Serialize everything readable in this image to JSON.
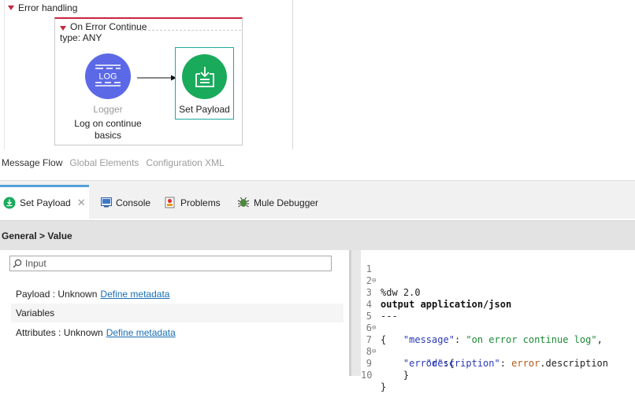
{
  "canvas": {
    "section_title": "Error handling",
    "scope": {
      "title": "On Error Continue",
      "subtitle": "type: ANY"
    },
    "logger": {
      "icon_text": "LOG",
      "type_label": "Logger",
      "name_line1": "Log on continue",
      "name_line2": "basics"
    },
    "set_payload": {
      "label": "Set Payload"
    }
  },
  "flow_tabs": [
    "Message Flow",
    "Global Elements",
    "Configuration XML"
  ],
  "view_tabs": [
    {
      "label": "Set Payload",
      "icon": "set-payload-icon"
    },
    {
      "label": "Console",
      "icon": "console-icon"
    },
    {
      "label": "Problems",
      "icon": "problems-icon"
    },
    {
      "label": "Mule Debugger",
      "icon": "debugger-icon"
    }
  ],
  "breadcrumb": "General > Value",
  "metadata": {
    "search_placeholder": "Input",
    "payload_label": "Payload : Unknown",
    "payload_link": "Define metadata",
    "variables_label": "Variables",
    "attributes_label": "Attributes : Unknown",
    "attributes_link": "Define metadata"
  },
  "code": {
    "line_numbers": [
      "1",
      "2",
      "3",
      "4",
      "5",
      "6",
      "7",
      "8",
      "9",
      "10"
    ],
    "l1": "%dw 2.0",
    "l3": "output application/json",
    "l4": "---",
    "l5": "{",
    "l6_key": "\"message\"",
    "l6_sep": ": ",
    "l6_val": "\"on error continue log\"",
    "l6_end": ",",
    "l7_key": "\"error\"",
    "l7_end": ":{",
    "l8_key": "\"description\"",
    "l8_sep": ": ",
    "l8_ident": "error",
    "l8_end": ".description",
    "l9": "}",
    "l10": "}"
  },
  "colors": {
    "scope_accent": "#c8263e",
    "logger": "#5c69e6",
    "set_payload": "#1aaa5c",
    "selection": "#1aa9a2",
    "active_tab": "#54a0d6",
    "link": "#1a6fb5"
  }
}
